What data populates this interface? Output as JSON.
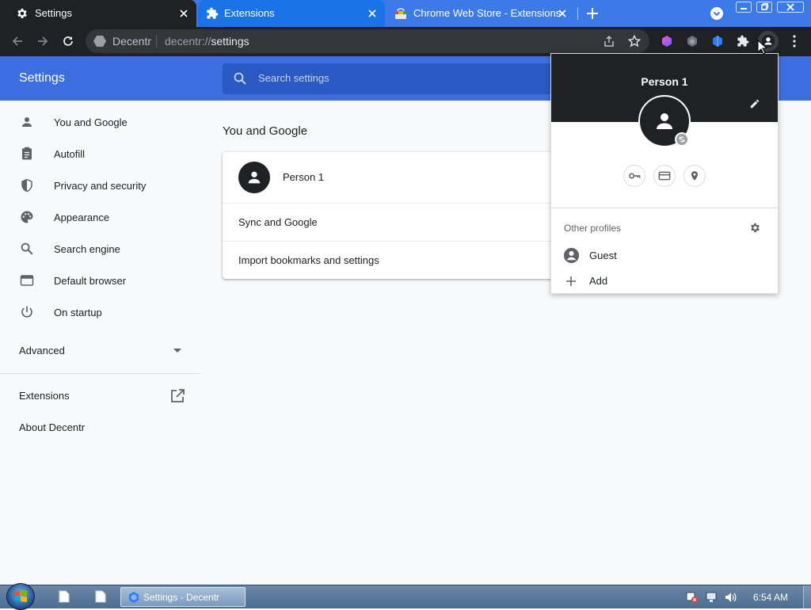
{
  "tabs": [
    {
      "title": "Settings",
      "icon": "gear-icon"
    },
    {
      "title": "Extensions",
      "icon": "puzzle-icon"
    },
    {
      "title": "Chrome Web Store - Extensions",
      "icon": "web-store-icon"
    }
  ],
  "omnibox": {
    "site_name": "Decentr",
    "url_scheme": "decentr://",
    "url_path": "settings"
  },
  "header": {
    "title": "Settings",
    "search_placeholder": "Search settings"
  },
  "sidebar": {
    "items": [
      {
        "label": "You and Google",
        "icon": "person-icon"
      },
      {
        "label": "Autofill",
        "icon": "clipboard-icon"
      },
      {
        "label": "Privacy and security",
        "icon": "shield-icon"
      },
      {
        "label": "Appearance",
        "icon": "palette-icon"
      },
      {
        "label": "Search engine",
        "icon": "search-icon"
      },
      {
        "label": "Default browser",
        "icon": "browser-window-icon"
      },
      {
        "label": "On startup",
        "icon": "power-icon"
      }
    ],
    "advanced": "Advanced",
    "extensions": "Extensions",
    "about": "About Decentr"
  },
  "main": {
    "section_title": "You and Google",
    "card": {
      "profile_name": "Person 1",
      "sync_label": "Sync and Google",
      "import_label": "Import bookmarks and settings"
    }
  },
  "profile_popup": {
    "name": "Person 1",
    "other_profiles_label": "Other profiles",
    "guest_label": "Guest",
    "add_label": "Add"
  },
  "taskbar": {
    "window_label": "Settings - Decentr",
    "clock": "6:54 AM"
  },
  "colors": {
    "accent": "#3d6ee0",
    "dark": "#202124",
    "tabstrip": "#3c7be7"
  }
}
